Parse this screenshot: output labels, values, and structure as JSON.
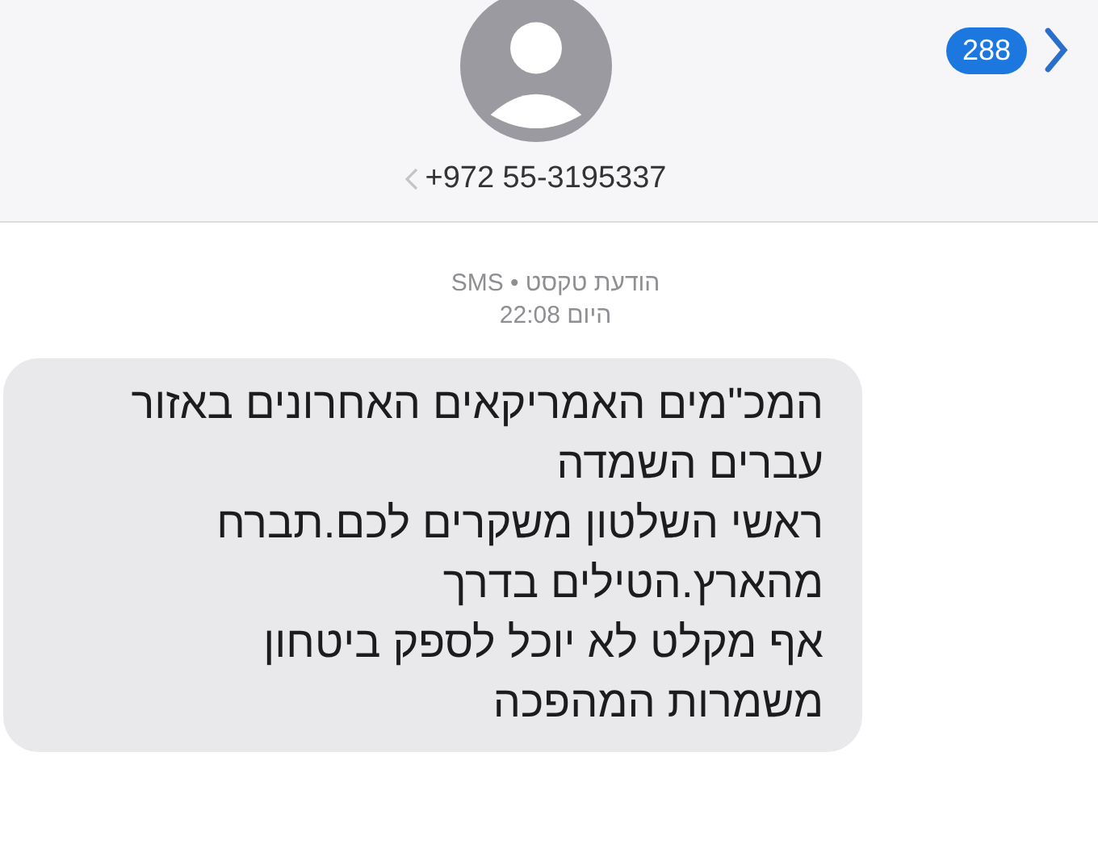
{
  "header": {
    "contact": "+972 55-3195337",
    "unread_count": "288"
  },
  "message_meta": {
    "service": "הודעת טקסט • SMS",
    "time": "היום 22:08"
  },
  "messages": [
    {
      "text": "המכ\"מים האמריקאים האחרונים באזור\nעברים השמדה\nראשי השלטון משקרים לכם.תברח\nמהארץ.הטילים בדרך\nאף מקלט לא יוכל לספק ביטחון\nמשמרות המהפכה",
      "kind": "incoming"
    }
  ]
}
